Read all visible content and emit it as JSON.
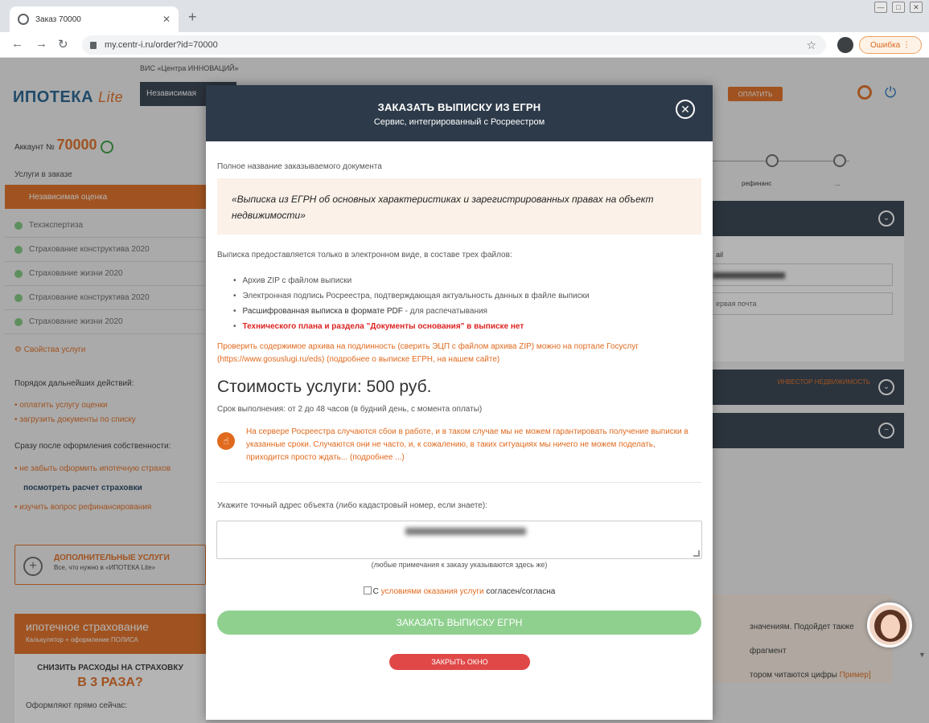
{
  "browser": {
    "tab_title": "Заказ 70000",
    "tab_close": "✕",
    "new_tab": "+",
    "url": "my.centr-i.ru/order?id=70000",
    "error_label": "Ошибка",
    "window_buttons": [
      "—",
      "□",
      "✕"
    ]
  },
  "page": {
    "subtitle": "ВИС «Центра ИННОВАЦИЙ»",
    "logo_main": "ИПОТЕКА",
    "logo_lite": "Lite",
    "top_select": "Независимая",
    "top_button": "ОПЛАТИТЬ",
    "account_label": "Аккаунт №",
    "account_number": "70000",
    "services_label": "Услуги в заказе",
    "active_service": "Независимая оценка",
    "services": [
      "Техэкспертиза",
      "Страхование конструктива 2020",
      "Страхование жизни 2020",
      "Страхование конструктива 2020",
      "Страхование жизни 2020"
    ],
    "service_props": "Свойства услуги",
    "next_steps_title": "Порядок дальнейших действий:",
    "next_steps": [
      "оплатить услугу оценки",
      "загрузить документы по списку"
    ],
    "after_title": "Сразу после оформления собственности:",
    "after_items": [
      "не забыть оформить ипотечную страхов",
      "посмотреть расчет страховки",
      "изучить вопрос рефинансирования"
    ],
    "extra_title": "ДОПОЛНИТЕЛЬНЫЕ УСЛУГИ",
    "extra_sub": "Все, что нужно в «ИПОТЕКА Lite»",
    "insurance_head": "ипотечное страхование",
    "insurance_sub": "Калькулятор + оформление ПОЛИСА",
    "insurance_t1": "СНИЗИТЬ РАСХОДЫ НА СТРАХОВКУ",
    "insurance_t2": "В 3 РАЗА?",
    "insurance_t3": "Оформляют прямо сейчас:",
    "step_label_1": "рефинанс",
    "step_label_2": "...",
    "right_field_label": "ail",
    "right_field_2": "ервая почта",
    "right_panel2_text": "ИНВЕСТОР НЕДВИЖИМОСТЬ",
    "right_bottom_1": "значениям. Подойдет также фрагмент",
    "right_bottom_2": "тором читаются цифры",
    "right_bottom_link": "Пример]"
  },
  "modal": {
    "title": "ЗАКАЗАТЬ ВЫПИСКУ ИЗ ЕГРН",
    "subtitle": "Сервис, интегрированный с Росреестром",
    "close_icon": "✕",
    "doc_label": "Полное название заказываемого документа",
    "doc_name": "«Выписка из ЕГРН об основных характеристиках и зарегистрированных правах на объект недвижимости»",
    "files_title": "Выписка предоставляется только в электронном виде, в составе трех файлов:",
    "files": [
      "Архив ZIP с файлом выписки",
      "Электронная подпись Росреестра, подтверждающая актуальность данных в файле выписки"
    ],
    "file_pdf_strong": "Расшифрованная выписка в формате PDF",
    "file_pdf_rest": " - для распечатывания",
    "file_red": "Технического плана и раздела \"Документы основания\" в выписке нет",
    "verify_text": "Проверить содержимое архива на подлинность (сверить ЭЦП с файлом архива ZIP) можно на портале Госуслуг (https://www.gosuslugi.ru/eds) (подробнее о выписке ЕГРН, на нашем сайте)",
    "price": "Стоимость услуги: 500 руб.",
    "term": "Срок выполнения: от 2 до 48 часов (в будний день, с момента оплаты)",
    "warning": "На сервере Росреестра случаются сбои в работе, и в таком случае мы не можем гарантировать получение выписки в указанные сроки. Случаются они не часто, и, к сожалению, в таких ситуациях мы ничего не можем поделать, приходится просто ждать... (подробнее ...)",
    "address_label": "Укажите точный адрес объекта (либо кадастровый номер, если знаете):",
    "note": "(любые примечания к заказу указываются здесь же)",
    "agree_pre": "С ",
    "agree_link": "условиями оказания услуги",
    "agree_post": " согласен/согласна",
    "order_button": "ЗАКАЗАТЬ ВЫПИСКУ ЕГРН",
    "close_button": "ЗАКРЫТЬ ОКНО"
  }
}
